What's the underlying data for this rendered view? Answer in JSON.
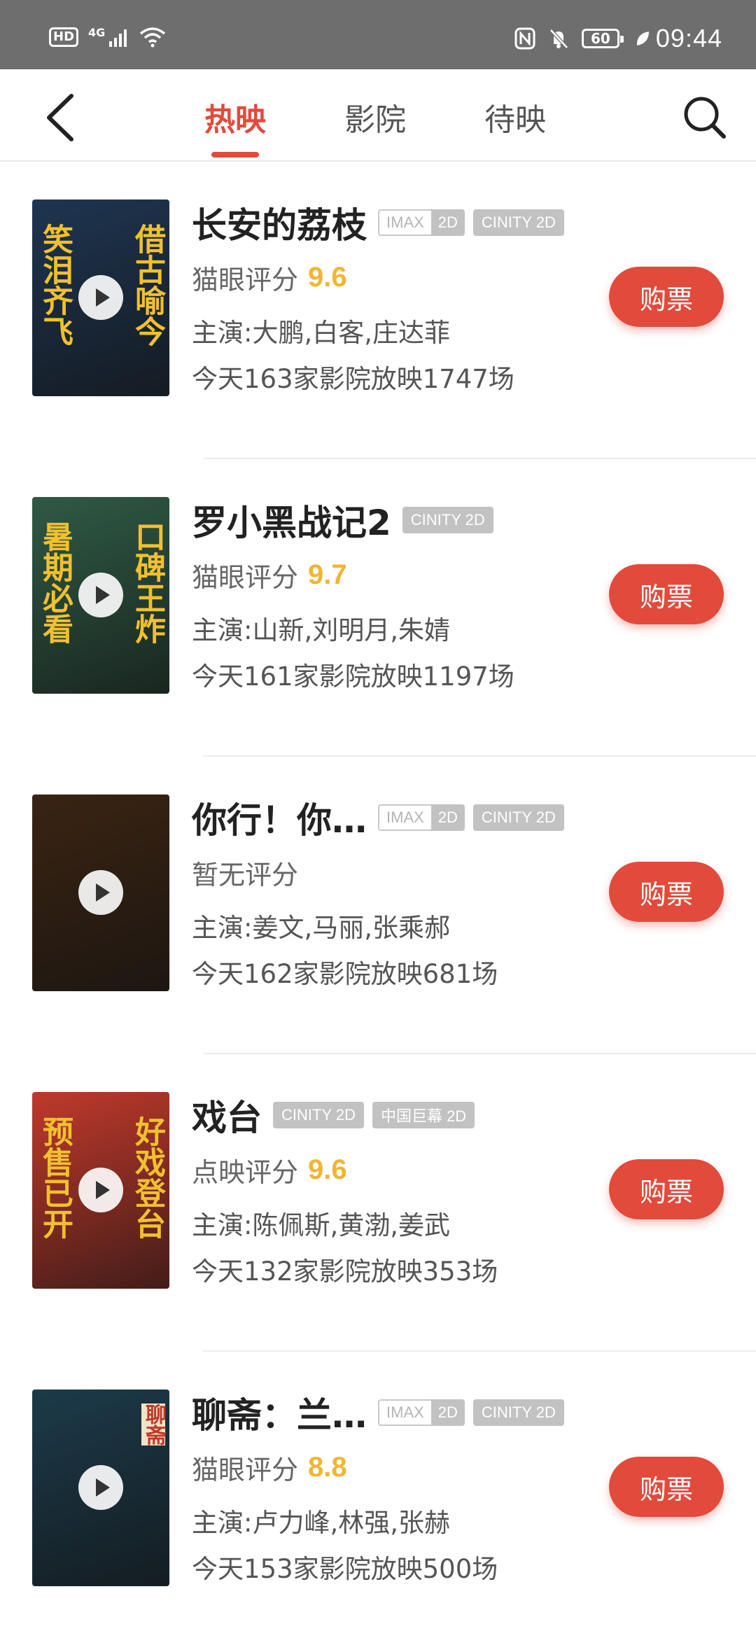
{
  "status_bar": {
    "hd": "HD",
    "network": "4G",
    "battery": "60",
    "time": "09:44"
  },
  "nav": {
    "tabs": [
      {
        "label": "热映",
        "active": true
      },
      {
        "label": "影院",
        "active": false
      },
      {
        "label": "待映",
        "active": false
      }
    ]
  },
  "movies": [
    {
      "title": "长安的荔枝",
      "tags": [
        {
          "k": "IMAX",
          "v": "2D"
        },
        {
          "text": "CINITY 2D"
        }
      ],
      "score_label": "猫眼评分",
      "score": "9.6",
      "actors": "主演:大鹏,白客,庄达菲",
      "shows": "今天163家影院放映1747场",
      "buy_label": "购票",
      "poster": {
        "left": "笑泪齐飞",
        "right": "借古喻今",
        "bg": "#1e3550"
      }
    },
    {
      "title": "罗小黑战记2",
      "tags": [
        {
          "text": "CINITY 2D"
        }
      ],
      "score_label": "猫眼评分",
      "score": "9.7",
      "actors": "主演:山新,刘明月,朱婧",
      "shows": "今天161家影院放映1197场",
      "buy_label": "购票",
      "poster": {
        "left": "暑期必看",
        "right": "口碑王炸",
        "bg": "#2f5a45"
      }
    },
    {
      "title": "你行！你…",
      "tags": [
        {
          "k": "IMAX",
          "v": "2D"
        },
        {
          "text": "CINITY 2D"
        }
      ],
      "score_label": "暂无评分",
      "score": "",
      "actors": "主演:姜文,马丽,张乘郝",
      "shows": "今天162家影院放映681场",
      "buy_label": "购票",
      "poster": {
        "left": "",
        "right": "",
        "bg": "#3a2412"
      }
    },
    {
      "title": "戏台",
      "tags": [
        {
          "text": "CINITY 2D"
        },
        {
          "text": "中国巨幕 2D"
        }
      ],
      "score_label": "点映评分",
      "score": "9.6",
      "actors": "主演:陈佩斯,黄渤,姜武",
      "shows": "今天132家影院放映353场",
      "buy_label": "购票",
      "poster": {
        "left": "预售已开",
        "right": "好戏登台",
        "bg": "#c0392b"
      }
    },
    {
      "title": "聊斋：兰…",
      "tags": [
        {
          "k": "IMAX",
          "v": "2D"
        },
        {
          "text": "CINITY 2D"
        }
      ],
      "score_label": "猫眼评分",
      "score": "8.8",
      "actors": "主演:卢力峰,林强,张赫",
      "shows": "今天153家影院放映500场",
      "buy_label": "购票",
      "poster": {
        "left": "",
        "right": "聊斋",
        "bg": "#1c3a4a"
      }
    }
  ]
}
